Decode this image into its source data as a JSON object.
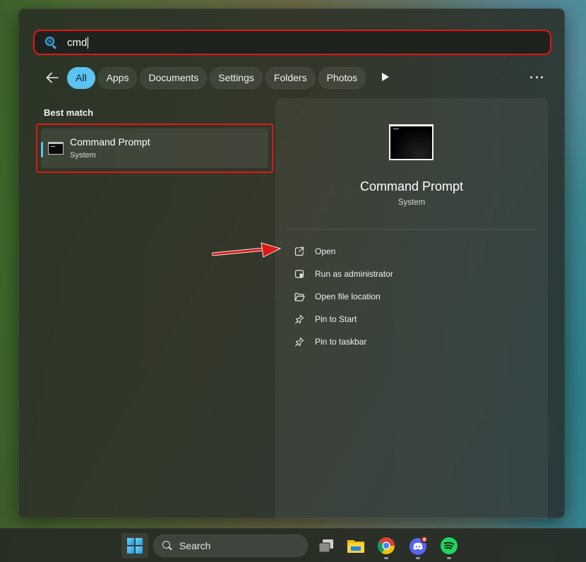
{
  "search": {
    "query": "cmd"
  },
  "filters": {
    "back_label": "Back",
    "chips": [
      {
        "label": "All",
        "active": true
      },
      {
        "label": "Apps",
        "active": false
      },
      {
        "label": "Documents",
        "active": false
      },
      {
        "label": "Settings",
        "active": false
      },
      {
        "label": "Folders",
        "active": false
      },
      {
        "label": "Photos",
        "active": false
      }
    ],
    "more_icon": "play-icon",
    "options_icon": "more-options-icon"
  },
  "results": {
    "section_title": "Best match",
    "best_match": {
      "title": "Command Prompt",
      "subtitle": "System",
      "icon": "terminal-icon"
    }
  },
  "detail": {
    "title": "Command Prompt",
    "subtitle": "System",
    "actions": [
      {
        "label": "Open",
        "icon": "open-external-icon"
      },
      {
        "label": "Run as administrator",
        "icon": "shield-admin-icon"
      },
      {
        "label": "Open file location",
        "icon": "folder-open-icon"
      },
      {
        "label": "Pin to Start",
        "icon": "pin-icon"
      },
      {
        "label": "Pin to taskbar",
        "icon": "pin-icon"
      }
    ]
  },
  "taskbar": {
    "search_label": "Search",
    "apps": [
      "start",
      "task-view",
      "file-explorer",
      "chrome",
      "discord",
      "spotify"
    ]
  },
  "colors": {
    "accent": "#5cc3f3",
    "highlight_border": "#e01717",
    "annotation_arrow": "#e01717"
  }
}
